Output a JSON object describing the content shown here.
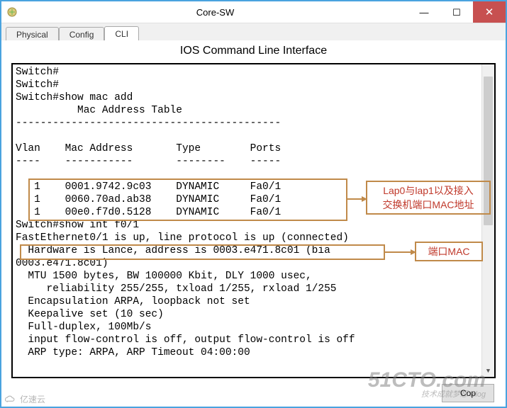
{
  "window": {
    "title": "Core-SW"
  },
  "tabs": {
    "physical": "Physical",
    "config": "Config",
    "cli": "CLI"
  },
  "cli": {
    "title": "IOS Command Line Interface",
    "lines": {
      "l1": "Switch#",
      "l2": "Switch#",
      "l3": "Switch#show mac add",
      "l4": "          Mac Address Table",
      "l5": "-------------------------------------------",
      "l6": "",
      "l7": "Vlan    Mac Address       Type        Ports",
      "l8": "----    -----------       --------    -----",
      "l9": "",
      "l10": "   1    0001.9742.9c03    DYNAMIC     Fa0/1",
      "l11": "   1    0060.70ad.ab38    DYNAMIC     Fa0/1",
      "l12": "   1    00e0.f7d0.5128    DYNAMIC     Fa0/1",
      "l13": "Switch#show int f0/1",
      "l14": "FastEthernet0/1 is up, line protocol is up (connected)",
      "l15": "  Hardware is Lance, address is 0003.e471.8c01 (bia",
      "l16": "0003.e471.8c01)",
      "l17": "  MTU 1500 bytes, BW 100000 Kbit, DLY 1000 usec,",
      "l18": "     reliability 255/255, txload 1/255, rxload 1/255",
      "l19": "  Encapsulation ARPA, loopback not set",
      "l20": "  Keepalive set (10 sec)",
      "l21": "  Full-duplex, 100Mb/s",
      "l22": "  input flow-control is off, output flow-control is off",
      "l23": "  ARP type: ARPA, ARP Timeout 04:00:00"
    }
  },
  "annotations": {
    "mac_label_line1": "Lap0与lap1以及接入",
    "mac_label_line2": "交换机端口MAC地址",
    "hw_label": "端口MAC"
  },
  "buttons": {
    "copy": "Cop"
  },
  "watermarks": {
    "w1_main": "51CTO.com",
    "w1_sub": "技术成就梦想  Blog",
    "w2": "亿速云"
  },
  "chart_data": {
    "type": "table",
    "title": "Mac Address Table",
    "columns": [
      "Vlan",
      "Mac Address",
      "Type",
      "Ports"
    ],
    "rows": [
      [
        1,
        "0001.9742.9c03",
        "DYNAMIC",
        "Fa0/1"
      ],
      [
        1,
        "0060.70ad.ab38",
        "DYNAMIC",
        "Fa0/1"
      ],
      [
        1,
        "00e0.f7d0.5128",
        "DYNAMIC",
        "Fa0/1"
      ]
    ]
  }
}
